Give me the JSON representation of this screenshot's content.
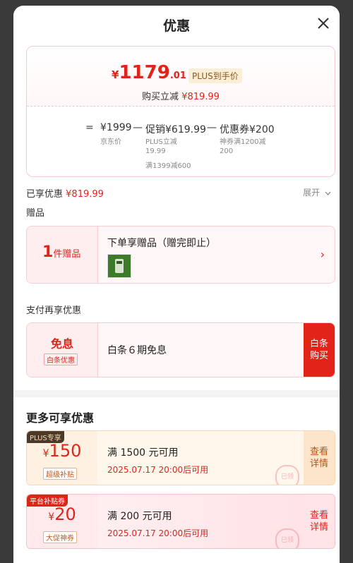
{
  "header": {
    "title": "优惠"
  },
  "summary": {
    "currency": "¥",
    "price_int": "1179",
    "price_dec": ".01",
    "plus_tag": "PLUS到手价",
    "instant_label": "购买立减",
    "instant_value": "¥819.99",
    "formula": {
      "eq": "=",
      "jd_price": "¥1999",
      "minus1": "—",
      "promo": "促销¥619.99",
      "minus2": "—",
      "coupon": "优惠券¥200",
      "jd_price_label": "京东价",
      "promo_sub_1": "PLUS立减",
      "promo_sub_2": "19.99",
      "promo_sub_3": "满1399减600",
      "coupon_sub_1": "神券满1200减",
      "coupon_sub_2": "200"
    }
  },
  "enjoyed": {
    "label": "已享优惠",
    "value": "¥819.99",
    "expand": "展开"
  },
  "gifts": {
    "section": "赠品",
    "count": "1",
    "count_unit": "件赠品",
    "text": "下单享赠品（赠完即止）"
  },
  "payment": {
    "section": "支付再享优惠",
    "big": "免息",
    "tag": "白条优惠",
    "text": "白条６期免息",
    "btn_line1": "白条",
    "btn_line2": "购买"
  },
  "more": {
    "title": "更多可享优惠",
    "coupons": [
      {
        "corner": "PLUS专享",
        "currency": "¥",
        "amount": "150",
        "label": "超级补贴",
        "condition": "满 1500 元可用",
        "date": "2025.07.17 20:00后可用",
        "btn_line1": "查看",
        "btn_line2": "详情",
        "stamp": "已领"
      },
      {
        "corner": "平台补贴券",
        "currency": "¥",
        "amount": "20",
        "label": "大促神券",
        "condition": "满 200 元可用",
        "date": "2025.07.17 20:00后可用",
        "btn_line1": "查看",
        "btn_line2": "详情",
        "stamp": "已领"
      }
    ]
  },
  "colors": {
    "accent": "#e2231a",
    "plus_gold": "#8a5a1d"
  }
}
